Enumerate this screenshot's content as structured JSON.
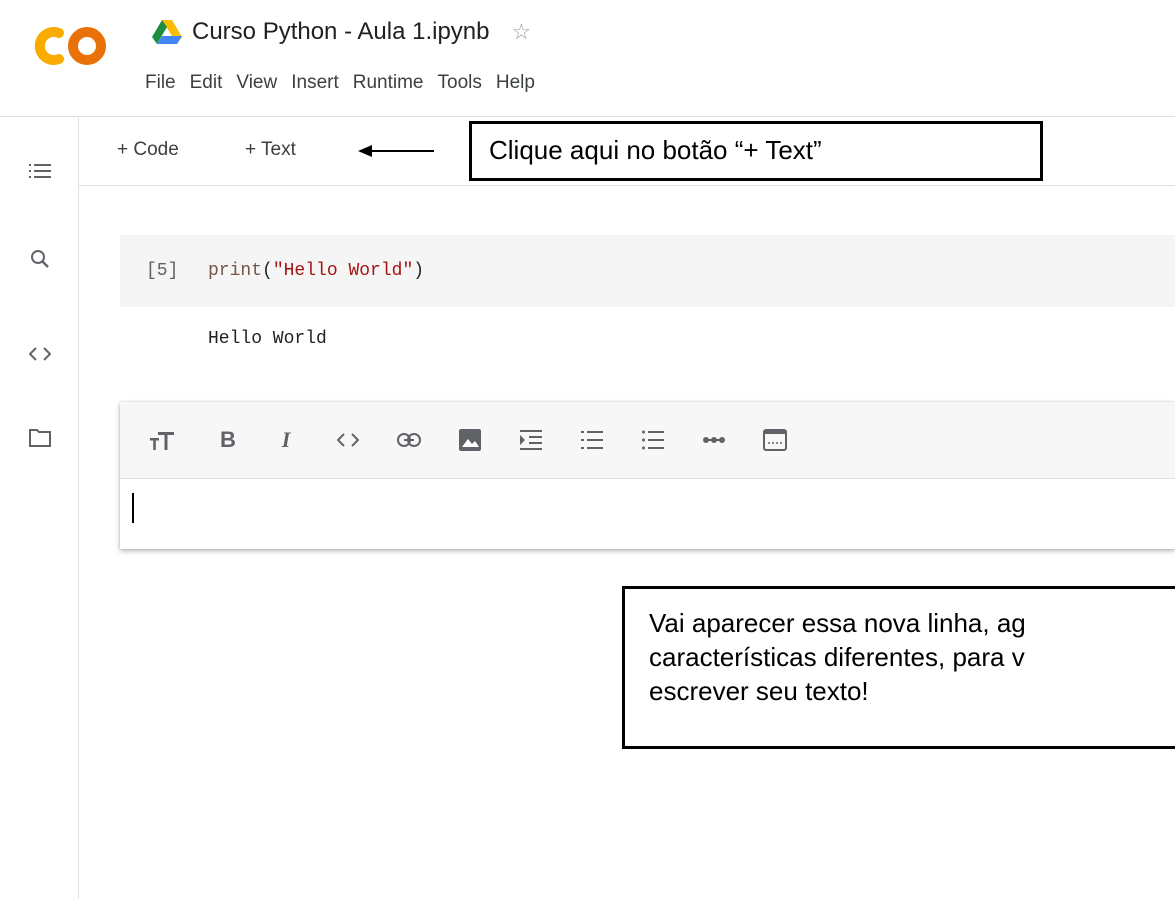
{
  "app": {
    "name": "Google Colaboratory",
    "brand_colors": {
      "orange": "#f9ab00",
      "orange_dark": "#e8710a"
    }
  },
  "header": {
    "title": "Curso Python - Aula 1.ipynb",
    "menu": [
      "File",
      "Edit",
      "View",
      "Insert",
      "Runtime",
      "Tools",
      "Help"
    ]
  },
  "sidebar": {
    "icons": [
      "table-of-contents-icon",
      "search-icon",
      "code-snippets-icon",
      "files-icon"
    ]
  },
  "toolbar": {
    "add_code_label": "+ Code",
    "add_text_label": "+ Text"
  },
  "annotations": {
    "callout1": "Clique aqui no botão “+ Text”",
    "callout2": "Vai aparecer essa nova linha, ag\ncaracterísticas diferentes, para v\nescrever seu texto!"
  },
  "cells": {
    "code": {
      "exec_count": "[5]",
      "fn": "print",
      "open": "(",
      "arg": "\"Hello World\"",
      "close": ")",
      "output": "Hello World"
    },
    "text": {
      "format_buttons": [
        "heading-icon",
        "bold-icon",
        "italic-icon",
        "code-icon",
        "link-icon",
        "image-icon",
        "indent-icon",
        "numbered-list-icon",
        "bulleted-list-icon",
        "horizontal-rule-icon",
        "mode-toggle-icon"
      ],
      "bold_glyph": "B",
      "italic_glyph": "I"
    }
  }
}
